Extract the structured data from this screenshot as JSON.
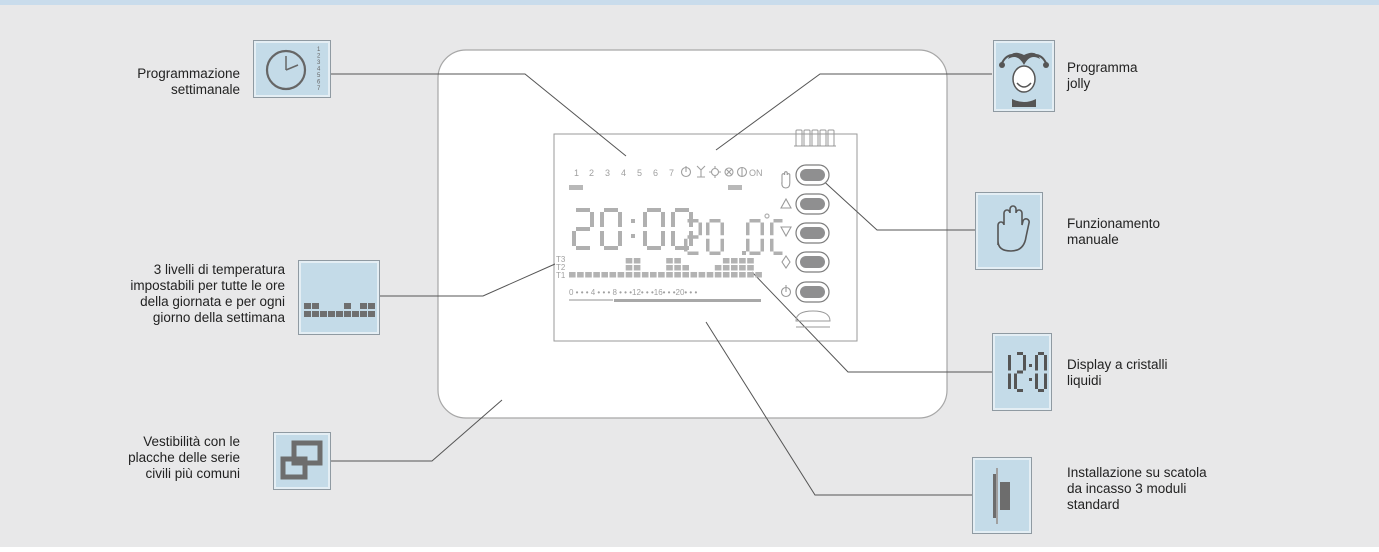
{
  "features": {
    "weekly_programming": "Programmazione\nsettimanale",
    "temperature_levels": "3 livelli di temperatura\nimpostabili per tutte le ore\ndella giornata e per ogni\ngiorno della settimana",
    "cover_plates": "Vestibilità con le\nplacche delle serie\ncivili più comuni",
    "jolly_program": "Programma\njolly",
    "manual_operation": "Funzionamento\nmanuale",
    "lcd_display": "Display a cristalli\nliquidi",
    "installation": "Installazione su scatola\nda incasso 3 moduli\nstandard"
  },
  "icons": {
    "weekly_programming": "clock-icon",
    "weekly_day_numbers": "1234567",
    "temperature_levels": "bar-graph-icon",
    "cover_plates": "overlapping-frames-icon",
    "jolly_program": "jester-icon",
    "manual_operation": "hand-icon",
    "lcd_display": "digital-digits-icon",
    "lcd_display_digits": "12:0",
    "installation": "wall-box-icon"
  },
  "display": {
    "days": [
      "1",
      "2",
      "3",
      "4",
      "5",
      "6",
      "7"
    ],
    "mode_on": "ON",
    "time": "20:00",
    "temperature": "20.0",
    "temperature_unit": "°C",
    "levels": [
      "T3",
      "T2",
      "T1"
    ],
    "hour_scale": "0 • • • 4 • • • 8 • • •12• • •16• • •20• • •",
    "button_symbols": [
      "hand",
      "up",
      "down",
      "diamond",
      "power"
    ]
  },
  "colors": {
    "background": "#e8e8e9",
    "icon_fill": "#c4dbe8",
    "lcd_segment": "#b0b0b0",
    "button": "#8f8f90"
  }
}
